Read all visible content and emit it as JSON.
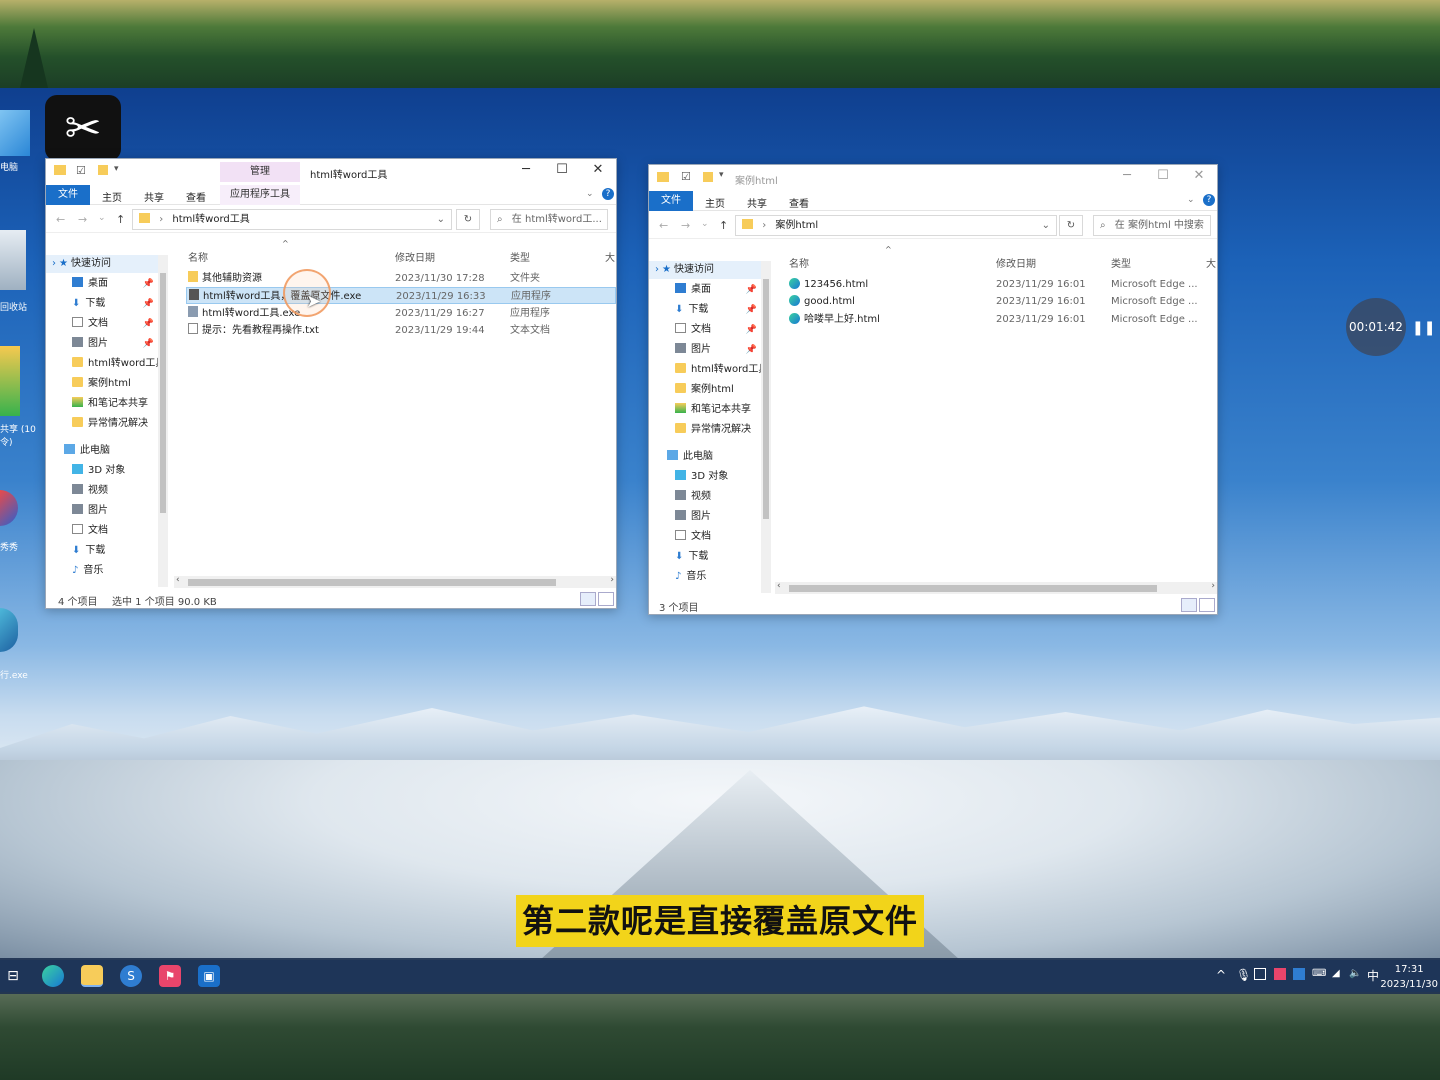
{
  "desktop": {
    "icons": [
      {
        "label": "电脑"
      },
      {
        "label": "回收站"
      },
      {
        "label": "共享 (10"
      },
      {
        "label": "令)"
      },
      {
        "label": "秀秀"
      },
      {
        "label": "行.exe"
      }
    ]
  },
  "left_window": {
    "title": "html转word工具",
    "manage_tab": "管理",
    "app_tools_tab": "应用程序工具",
    "ribbon_tabs": {
      "file": "文件",
      "home": "主页",
      "share": "共享",
      "view": "查看"
    },
    "address": "html转word工具",
    "search_placeholder": "在 html转word工...",
    "nav_pane": [
      {
        "label": "快速访问"
      },
      {
        "label": "桌面"
      },
      {
        "label": "下载"
      },
      {
        "label": "文档"
      },
      {
        "label": "图片"
      },
      {
        "label": "html转word工具"
      },
      {
        "label": "案例html"
      },
      {
        "label": "和笔记本共享"
      },
      {
        "label": "异常情况解决"
      },
      {
        "label": "此电脑"
      },
      {
        "label": "3D 对象"
      },
      {
        "label": "视频"
      },
      {
        "label": "图片"
      },
      {
        "label": "文档"
      },
      {
        "label": "下载"
      },
      {
        "label": "音乐"
      }
    ],
    "columns": {
      "name": "名称",
      "date": "修改日期",
      "type": "类型",
      "size": "大"
    },
    "files": [
      {
        "name": "其他辅助资源",
        "date": "2023/11/30 17:28",
        "type": "文件夹"
      },
      {
        "name": "html转word工具，覆盖原文件.exe",
        "date": "2023/11/29 16:33",
        "type": "应用程序"
      },
      {
        "name": "html转word工具.exe",
        "date": "2023/11/29 16:27",
        "type": "应用程序"
      },
      {
        "name": "提示：先看教程再操作.txt",
        "date": "2023/11/29 19:44",
        "type": "文本文档"
      }
    ],
    "status_count": "4 个项目",
    "status_selected": "选中 1 个项目  90.0 KB"
  },
  "right_window": {
    "title": "案例html",
    "ribbon_tabs": {
      "file": "文件",
      "home": "主页",
      "share": "共享",
      "view": "查看"
    },
    "address": "案例html",
    "search_placeholder": "在 案例html 中搜索",
    "nav_pane": [
      {
        "label": "快速访问"
      },
      {
        "label": "桌面"
      },
      {
        "label": "下载"
      },
      {
        "label": "文档"
      },
      {
        "label": "图片"
      },
      {
        "label": "html转word工具"
      },
      {
        "label": "案例html"
      },
      {
        "label": "和笔记本共享"
      },
      {
        "label": "异常情况解决"
      },
      {
        "label": "此电脑"
      },
      {
        "label": "3D 对象"
      },
      {
        "label": "视频"
      },
      {
        "label": "图片"
      },
      {
        "label": "文档"
      },
      {
        "label": "下载"
      },
      {
        "label": "音乐"
      }
    ],
    "columns": {
      "name": "名称",
      "date": "修改日期",
      "type": "类型",
      "size": "大"
    },
    "files": [
      {
        "name": "123456.html",
        "date": "2023/11/29 16:01",
        "type": "Microsoft Edge ..."
      },
      {
        "name": "good.html",
        "date": "2023/11/29 16:01",
        "type": "Microsoft Edge ..."
      },
      {
        "name": "哈喽早上好.html",
        "date": "2023/11/29 16:01",
        "type": "Microsoft Edge ..."
      }
    ],
    "status_count": "3 个项目"
  },
  "recorder": {
    "elapsed": "00:01:42"
  },
  "subtitle": "第二款呢是直接覆盖原文件",
  "taskbar": {
    "ime": "中",
    "time": "17:31",
    "date": "2023/11/30"
  }
}
